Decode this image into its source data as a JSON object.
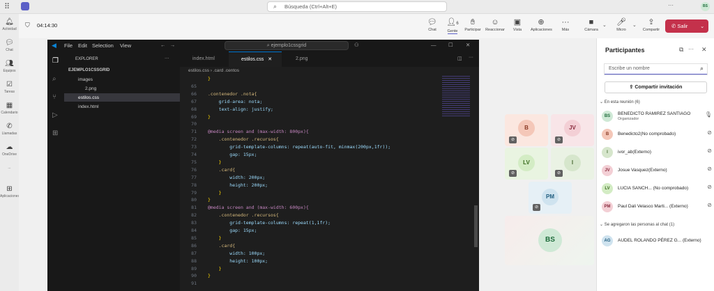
{
  "topbar": {
    "search_placeholder": "Búsqueda (Ctrl+Alt+E)",
    "user_initials": "BS"
  },
  "rail": {
    "items": [
      "Actividad",
      "Chat",
      "Equipos",
      "Tareas",
      "Calendario",
      "Llamadas",
      "OneDrive",
      "...",
      "Aplicaciones"
    ]
  },
  "meeting": {
    "timer": "04:14:30",
    "tools": {
      "chat": "Chat",
      "people": "Gente",
      "people_count": "6",
      "raise": "Participar",
      "react": "Reaccionar",
      "view": "Vista",
      "apps": "Aplicaciones",
      "more": "Más",
      "camera": "Cámara",
      "mic": "Micro",
      "share": "Compartir",
      "leave": "Salir"
    }
  },
  "vscode": {
    "menu": [
      "File",
      "Edit",
      "Selection",
      "View"
    ],
    "search": "ejemplo1cssgrid",
    "explorer_title": "EXPLORER",
    "root": "EJEMPLO1CSSGRID",
    "tree": [
      "images",
      "2.png",
      "estilos.css",
      "index.html"
    ],
    "tabs": [
      "index.html",
      "estilos.css",
      "2.png"
    ],
    "breadcrumb": [
      "estilos.css",
      ".card .centos"
    ],
    "lines": [
      {
        "n": "",
        "t": "}"
      },
      {
        "n": "65",
        "t": ""
      },
      {
        "n": "66",
        "t": ".contenedor .nota{"
      },
      {
        "n": "67",
        "t": "    grid-area: nota;"
      },
      {
        "n": "68",
        "t": "    text-align: justify;"
      },
      {
        "n": "69",
        "t": "}"
      },
      {
        "n": "70",
        "t": ""
      },
      {
        "n": "71",
        "t": "@media screen and (max-width: 800px){"
      },
      {
        "n": "72",
        "t": "    .contenedor .recursos{"
      },
      {
        "n": "73",
        "t": "        grid-template-columns: repeat(auto-fit, minmax(200px,1fr));"
      },
      {
        "n": "74",
        "t": "        gap: 15px;"
      },
      {
        "n": "75",
        "t": "    }"
      },
      {
        "n": "76",
        "t": "    .card{"
      },
      {
        "n": "77",
        "t": "        width: 200px;"
      },
      {
        "n": "78",
        "t": "        height: 200px;"
      },
      {
        "n": "79",
        "t": "    }"
      },
      {
        "n": "80",
        "t": "}"
      },
      {
        "n": "81",
        "t": "@media screen and (max-width: 600px){"
      },
      {
        "n": "82",
        "t": "    .contenedor .recursos{"
      },
      {
        "n": "83",
        "t": "        grid-template-columns: repeat(1,1fr);"
      },
      {
        "n": "84",
        "t": "        gap: 15px;"
      },
      {
        "n": "85",
        "t": "    }"
      },
      {
        "n": "86",
        "t": "    .card{"
      },
      {
        "n": "87",
        "t": "        width: 100px;"
      },
      {
        "n": "88",
        "t": "        height: 100px;"
      },
      {
        "n": "89",
        "t": "    }"
      },
      {
        "n": "90",
        "t": "}"
      },
      {
        "n": "91",
        "t": ""
      }
    ]
  },
  "tiles": [
    {
      "initials": "B",
      "color": "#f4c7b8",
      "fg": "#8a3a25"
    },
    {
      "initials": "JV",
      "color": "#f3cfd5",
      "fg": "#8b2d3f"
    },
    {
      "initials": "LV",
      "color": "#d3ecc4",
      "fg": "#3a6b1e"
    },
    {
      "initials": "I",
      "color": "#d6e6cc",
      "fg": "#4a6b35"
    },
    {
      "initials": "PM",
      "color": "#cfe3ef",
      "fg": "#205d7f"
    },
    {
      "initials": "BS",
      "color": "#cfe9d6",
      "fg": "#1d6b3a"
    }
  ],
  "panel": {
    "title": "Participantes",
    "search_placeholder": "Escribe un nombre",
    "share_invite": "Compartir invitación",
    "in_meeting": "En esta reunión (6)",
    "participants": [
      {
        "initials": "BS",
        "name": "BENEDICTO RAMIREZ SANTIAGO",
        "role": "Organizador",
        "bg": "#cfe9d6",
        "fg": "#1d6b3a",
        "mic": "on"
      },
      {
        "initials": "B",
        "name": "Benedicto2(No comprobado)",
        "role": "",
        "bg": "#f4c7b8",
        "fg": "#8a3a25",
        "mic": "off"
      },
      {
        "initials": "I",
        "name": "ivor_ab(Externo)",
        "role": "",
        "bg": "#d6e6cc",
        "fg": "#4a6b35",
        "mic": "off"
      },
      {
        "initials": "JV",
        "name": "Josue Vasquez(Externo)",
        "role": "",
        "bg": "#f3cfd5",
        "fg": "#8b2d3f",
        "mic": "off"
      },
      {
        "initials": "LV",
        "name": "LUCIA SANCH... (No comprobado)",
        "role": "",
        "bg": "#d3ecc4",
        "fg": "#3a6b1e",
        "mic": "off"
      },
      {
        "initials": "PM",
        "name": "Paul Dali Velasco Marti...  (Externo)",
        "role": "",
        "bg": "#f3cfd5",
        "fg": "#8b2d3f",
        "mic": "off"
      }
    ],
    "added_to_chat": "Se agregaron las personas al chat (1)",
    "chat_people": [
      {
        "initials": "AG",
        "name": "AUDEL ROLANDO PÉREZ G... (Externo)",
        "bg": "#cfe3ef",
        "fg": "#205d7f"
      }
    ]
  }
}
